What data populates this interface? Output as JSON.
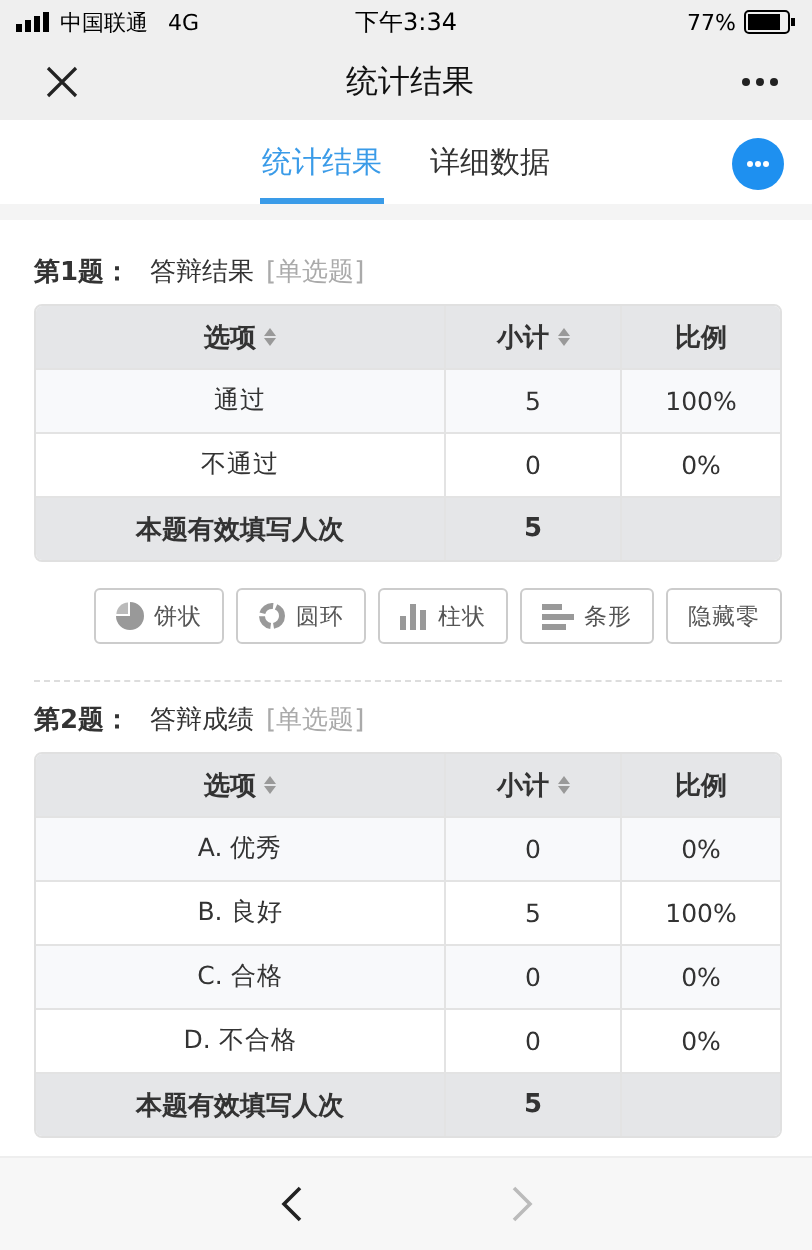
{
  "status_bar": {
    "carrier": "中国联通",
    "network": "4G",
    "time": "下午3:34",
    "battery": "77%"
  },
  "nav_bar": {
    "title": "统计结果"
  },
  "tabs": [
    {
      "label": "统计结果",
      "selected": true
    },
    {
      "label": "详细数据",
      "selected": false
    }
  ],
  "questions": [
    {
      "number": "第1题：",
      "title": "答辩结果",
      "type": "[单选题]",
      "columns": [
        "选项",
        "小计",
        "比例"
      ],
      "rows": [
        [
          "通过",
          "5",
          "100%"
        ],
        [
          "不通过",
          "0",
          "0%"
        ]
      ],
      "total": {
        "label": "本题有效填写人次",
        "count": "5"
      },
      "chart_buttons": [
        {
          "kind": "pie",
          "label": "饼状"
        },
        {
          "kind": "ring",
          "label": "圆环"
        },
        {
          "kind": "column",
          "label": "柱状"
        },
        {
          "kind": "bar",
          "label": "条形"
        },
        {
          "kind": "text",
          "label": "隐藏零"
        }
      ]
    },
    {
      "number": "第2题：",
      "title": "答辩成绩",
      "type": "[单选题]",
      "columns": [
        "选项",
        "小计",
        "比例"
      ],
      "rows": [
        [
          "A. 优秀",
          "0",
          "0%"
        ],
        [
          "B. 良好",
          "5",
          "100%"
        ],
        [
          "C. 合格",
          "0",
          "0%"
        ],
        [
          "D. 不合格",
          "0",
          "0%"
        ]
      ],
      "total": {
        "label": "本题有效填写人次",
        "count": "5"
      }
    }
  ],
  "bottom_nav": [
    {
      "kind": "back",
      "disabled": false
    },
    {
      "kind": "forward",
      "disabled": true
    }
  ]
}
